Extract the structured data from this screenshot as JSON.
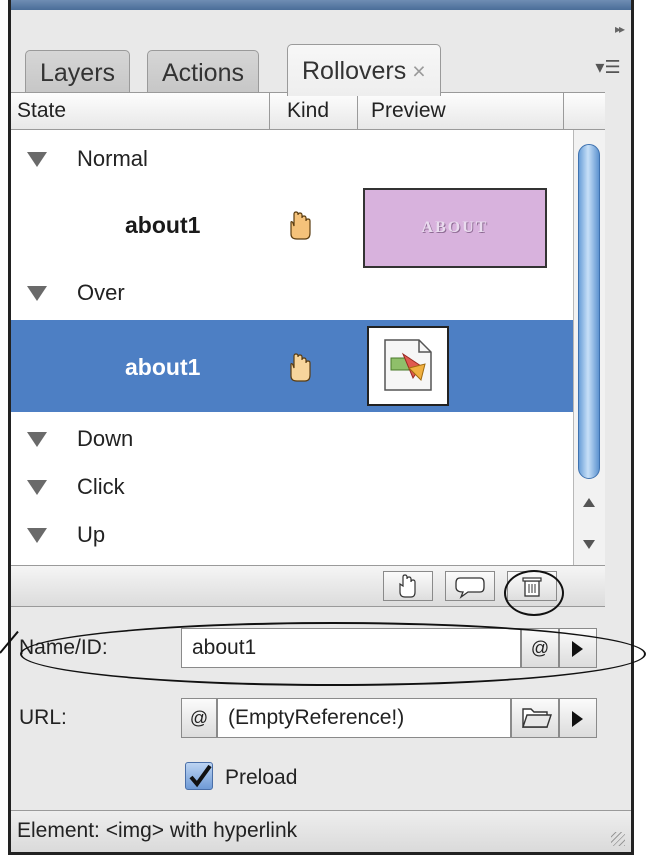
{
  "tabs": [
    {
      "label": "Layers"
    },
    {
      "label": "Actions"
    },
    {
      "label": "Rollovers",
      "close": "×"
    }
  ],
  "columns": {
    "state": "State",
    "kind": "Kind",
    "preview": "Preview"
  },
  "states": [
    {
      "label": "Normal",
      "items": [
        {
          "name": "about1",
          "preview_text": "ABOUT"
        }
      ]
    },
    {
      "label": "Over",
      "items": [
        {
          "name": "about1",
          "selected": true
        }
      ]
    },
    {
      "label": "Down"
    },
    {
      "label": "Click"
    },
    {
      "label": "Up"
    }
  ],
  "form": {
    "name_label": "Name/ID:",
    "name_value": "about1",
    "url_label": "URL:",
    "url_value": "(EmptyReference!)",
    "preload_label": "Preload",
    "preload_checked": true
  },
  "status": "Element: <img> with hyperlink",
  "colors": {
    "selection": "#4d7fc4",
    "preview_fill": "#d8b2dd",
    "scroll_thumb": "#6a9fd8"
  },
  "icons": [
    "hand-rollover-icon",
    "image-placeholder-icon",
    "new-rollover-icon",
    "comment-icon",
    "trash-icon",
    "at-target-icon",
    "folder-icon",
    "play-arrow-icon",
    "collapse-icon",
    "panel-menu-icon"
  ]
}
